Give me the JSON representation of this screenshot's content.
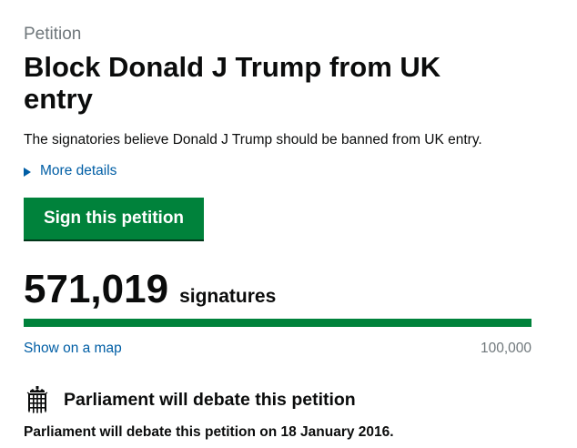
{
  "petition": {
    "caption": "Petition",
    "title": "Block Donald J Trump from UK entry",
    "summary": "The signatories believe Donald J Trump should be banned from UK entry.",
    "more_details_label": "More details",
    "sign_button_label": "Sign this petition"
  },
  "signatures": {
    "count": "571,019",
    "label": "signatures",
    "progress_fraction": 1.0,
    "map_link_label": "Show on a map",
    "threshold_label": "100,000"
  },
  "debate": {
    "icon": "portcullis-icon",
    "heading": "Parliament will debate this petition",
    "text": "Parliament will debate this petition on 18 January 2016."
  },
  "colors": {
    "accent_green": "#00823b",
    "link_blue": "#005ea5",
    "secondary_grey": "#6f777b",
    "text": "#0b0c0c"
  }
}
